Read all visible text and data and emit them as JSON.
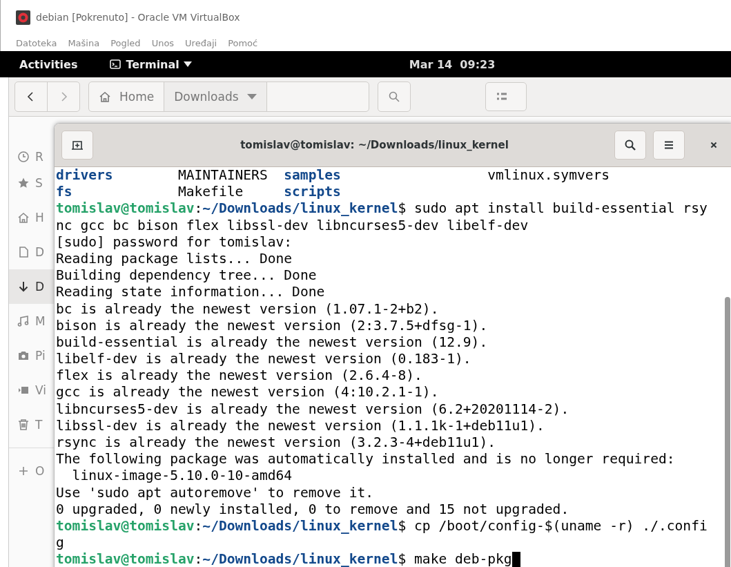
{
  "window": {
    "title": "debian [Pokrenuto] - Oracle VM VirtualBox"
  },
  "menu": [
    "Datoteka",
    "Mašina",
    "Pogled",
    "Unos",
    "Uređaji",
    "Pomoć"
  ],
  "top_bar": {
    "activities": "Activities",
    "app": "Terminal",
    "clock": "Mar 14  09:23"
  },
  "file_manager": {
    "path": [
      {
        "label": "Home",
        "selected": false
      },
      {
        "label": "Downloads",
        "selected": true
      }
    ],
    "sidebar": [
      {
        "label": "R",
        "selected": false
      },
      {
        "label": "S",
        "selected": false
      },
      {
        "label": "H",
        "selected": false
      },
      {
        "label": "D",
        "selected": false
      },
      {
        "label": "D",
        "selected": true
      },
      {
        "label": "M",
        "selected": false
      },
      {
        "label": "Pi",
        "selected": false
      },
      {
        "label": "Vi",
        "selected": false
      },
      {
        "label": "T",
        "selected": false
      },
      {
        "label": "O",
        "selected": false
      }
    ]
  },
  "terminal": {
    "title": "tomislav@tomislav: ~/Downloads/linux_kernel",
    "lines": [
      {
        "kind": "listing",
        "cells": [
          {
            "text": "drivers",
            "dir": true
          },
          {
            "text": "MAINTAINERS",
            "dir": false
          },
          {
            "text": "samples",
            "dir": true
          },
          {
            "text": "vmlinux.symvers",
            "dir": false
          }
        ]
      },
      {
        "kind": "listing",
        "cells": [
          {
            "text": "fs",
            "dir": true
          },
          {
            "text": "Makefile",
            "dir": false
          },
          {
            "text": "scripts",
            "dir": true
          }
        ]
      },
      {
        "kind": "prompt",
        "user": "tomislav@tomislav",
        "sep": ":",
        "path": "~/Downloads/linux_kernel",
        "command": "$ sudo apt install build-essential rsy"
      },
      {
        "kind": "text",
        "text": "nc gcc bc bison flex libssl-dev libncurses5-dev libelf-dev"
      },
      {
        "kind": "text",
        "text": "[sudo] password for tomislav:"
      },
      {
        "kind": "text",
        "text": "Reading package lists... Done"
      },
      {
        "kind": "text",
        "text": "Building dependency tree... Done"
      },
      {
        "kind": "text",
        "text": "Reading state information... Done"
      },
      {
        "kind": "text",
        "text": "bc is already the newest version (1.07.1-2+b2)."
      },
      {
        "kind": "text",
        "text": "bison is already the newest version (2:3.7.5+dfsg-1)."
      },
      {
        "kind": "text",
        "text": "build-essential is already the newest version (12.9)."
      },
      {
        "kind": "text",
        "text": "libelf-dev is already the newest version (0.183-1)."
      },
      {
        "kind": "text",
        "text": "flex is already the newest version (2.6.4-8)."
      },
      {
        "kind": "text",
        "text": "gcc is already the newest version (4:10.2.1-1)."
      },
      {
        "kind": "text",
        "text": "libncurses5-dev is already the newest version (6.2+20201114-2)."
      },
      {
        "kind": "text",
        "text": "libssl-dev is already the newest version (1.1.1k-1+deb11u1)."
      },
      {
        "kind": "text",
        "text": "rsync is already the newest version (3.2.3-4+deb11u1)."
      },
      {
        "kind": "text",
        "text": "The following package was automatically installed and is no longer required:"
      },
      {
        "kind": "text",
        "text": "  linux-image-5.10.0-10-amd64"
      },
      {
        "kind": "text",
        "text": "Use 'sudo apt autoremove' to remove it."
      },
      {
        "kind": "text",
        "text": "0 upgraded, 0 newly installed, 0 to remove and 15 not upgraded."
      },
      {
        "kind": "prompt",
        "user": "tomislav@tomislav",
        "sep": ":",
        "path": "~/Downloads/linux_kernel",
        "command": "$ cp /boot/config-$(uname -r) ./.confi"
      },
      {
        "kind": "text",
        "text": "g"
      },
      {
        "kind": "prompt",
        "cursor": true,
        "user": "tomislav@tomislav",
        "sep": ":",
        "path": "~/Downloads/linux_kernel",
        "command": "$ make deb-pkg"
      }
    ]
  }
}
